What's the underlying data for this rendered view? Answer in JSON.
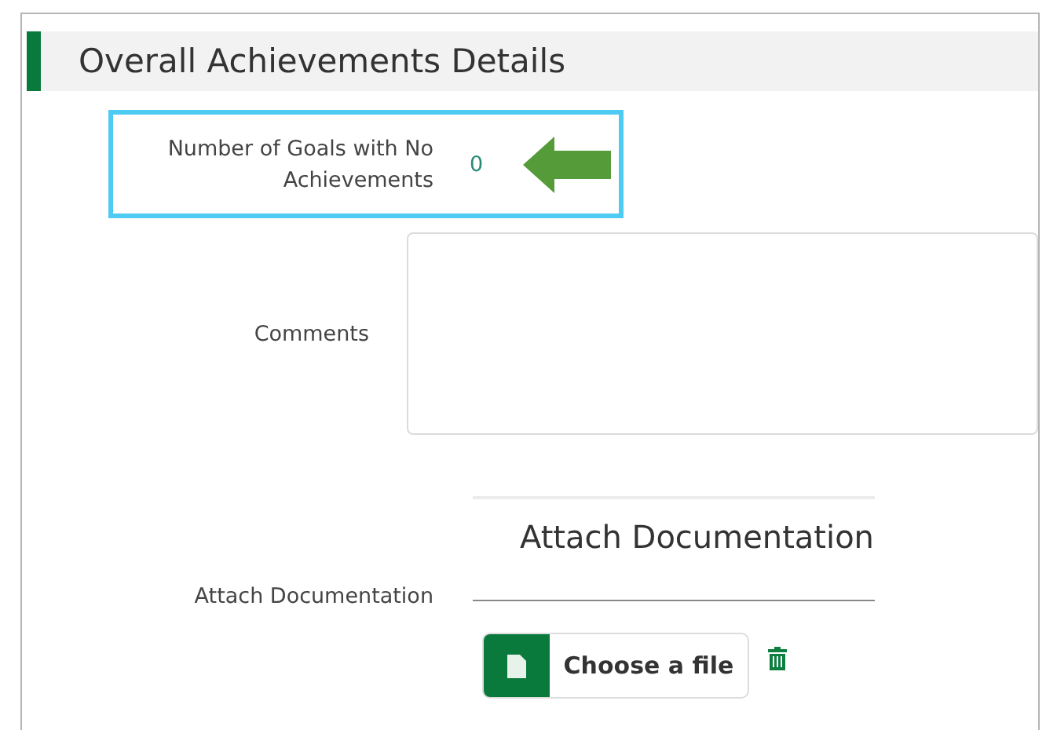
{
  "section": {
    "title": "Overall Achievements Details"
  },
  "goals_without_achievements": {
    "label": "Number of Goals with No Achievements",
    "value": "0",
    "highlighted": true
  },
  "comments": {
    "label": "Comments"
  },
  "attachment": {
    "label": "Attach Documentation",
    "heading": "Attach Documentation",
    "button": "Choose a file"
  }
}
